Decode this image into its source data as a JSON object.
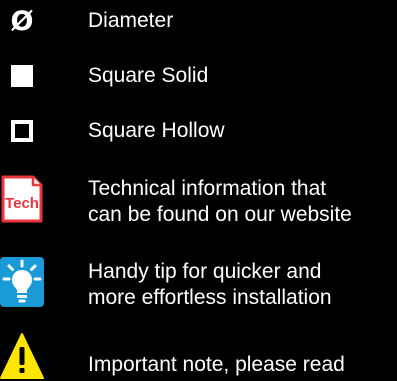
{
  "legend": {
    "items": [
      {
        "icon": "diameter-symbol-icon",
        "symbol": "Ø",
        "lines": [
          "Diameter"
        ]
      },
      {
        "icon": "square-solid-icon",
        "lines": [
          "Square Solid"
        ]
      },
      {
        "icon": "square-hollow-icon",
        "lines": [
          "Square Hollow"
        ]
      },
      {
        "icon": "tech-document-icon",
        "icon_text": "Tech",
        "lines": [
          "Technical information that",
          "can be found on our website"
        ]
      },
      {
        "icon": "lightbulb-tip-icon",
        "lines": [
          "Handy tip for quicker and",
          "more effortless installation"
        ]
      },
      {
        "icon": "warning-triangle-icon",
        "lines": [
          "Important note, please read"
        ]
      }
    ]
  },
  "colors": {
    "background": "#000000",
    "text": "#ffffff",
    "tech_red": "#e8363f",
    "tip_blue": "#1a9ad6",
    "warning_yellow": "#ffe600"
  }
}
